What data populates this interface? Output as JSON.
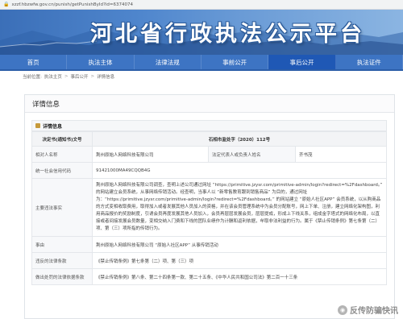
{
  "browser": {
    "url": "xzzf.hbzwfw.gov.cn/punish/getPunishById?id=6374074"
  },
  "site": {
    "title": "河北省行政执法公示平台"
  },
  "nav": {
    "items": [
      {
        "label": "首页"
      },
      {
        "label": "执法主体"
      },
      {
        "label": "法律法规"
      },
      {
        "label": "事前公开"
      },
      {
        "label": "事后公开"
      },
      {
        "label": "执法证件"
      }
    ],
    "active_index": 4
  },
  "breadcrumb": {
    "prefix": "当前位置:",
    "items": [
      "执法主页",
      "事后公开",
      "详情信息"
    ]
  },
  "panel": {
    "title": "详情信息"
  },
  "section": {
    "title": "详情信息"
  },
  "detail": {
    "doc_label": "决定书(通知书)文号",
    "doc_value": "石相市监处字（2020）112号",
    "rows": {
      "party_label": "相对人名称",
      "party_value": "荆州原始人网络科技有限公司",
      "rep_label": "法定代表人或负责人姓名",
      "rep_value": "齐书茂",
      "credit_label": "统一社会信用代码",
      "credit_value": "91421000MA49CQQB4G",
      "facts_label": "主要违法事实",
      "facts_value": "荆州原始人网络科技有限公司调查，查明上述公司通过网址 “https://primitive.jzysr.com/primitive-admin/login?redirect=%2Fdashboard。” 的网站建立会员系统，从事网络传销活动。经查明，当事人以 “新零售教育跟到销售商品” 为目的，通过网址为：“https://primitive.jzysr.com/primitive-admin/login?redirect=%2Fdashboard。” 的网站建立 “原始人社区APP” 会员系统，以从购商品的方式变相收取费用，取得加入或者发展其他人员加入的资格，并在该会员管理系统中为会员分配账号，网上下单、注册，建立网络化架构图，利用商品报价的奖励制度，引诱会员再度发展其他人员加入，会员再层层发展会员，层层提成，形成上下线关系，组成金字塔式的网络化布局，以直接或者间接发展会员数量，变相交纳入门费和下线的团队业绩作为计酬和返利依据，牟取非法利益的行为。属于《禁止传销条例》第七条第（二）项、第（三）项所指的传销行为。",
      "cause_label": "事由",
      "cause_value": "荆州原始人网络科技有限公司 “原始人社区APP” 从事传销活动",
      "violated_label": "违反的法律条款",
      "violated_value": "《禁止传销条例》第七条第（二）项、第（三）项",
      "basis_label": "做出处罚的法律依据条款",
      "basis_value": "《禁止传销条例》第八条、第二十四条第一款、第二十五条、《中华人民共和国公司法》第二百一十三条"
    }
  },
  "watermark": {
    "text": "反传防骗快讯"
  }
}
